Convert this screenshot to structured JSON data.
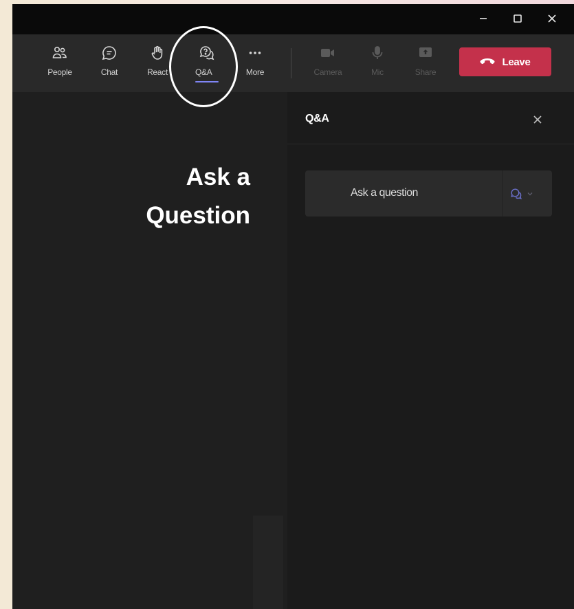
{
  "toolbar": {
    "people": "People",
    "chat": "Chat",
    "react": "React",
    "qa": "Q&A",
    "more": "More",
    "camera": "Camera",
    "mic": "Mic",
    "share": "Share",
    "leave": "Leave"
  },
  "annotation": {
    "line1": "Ask a",
    "line2": "Question"
  },
  "qa_panel": {
    "title": "Q&A",
    "ask_placeholder": "Ask a question"
  },
  "colors": {
    "leave": "#c4314b",
    "active_indicator": "#7f85f5",
    "background": "#1f1f1f"
  },
  "icons": {
    "people": "people-icon",
    "chat": "chat-icon",
    "react": "raised-hand-icon",
    "qa": "qa-icon",
    "more": "more-dots-icon",
    "camera": "camera-icon",
    "mic": "mic-icon",
    "share": "share-icon",
    "leave": "phone-hangup-icon",
    "close": "close-icon"
  }
}
